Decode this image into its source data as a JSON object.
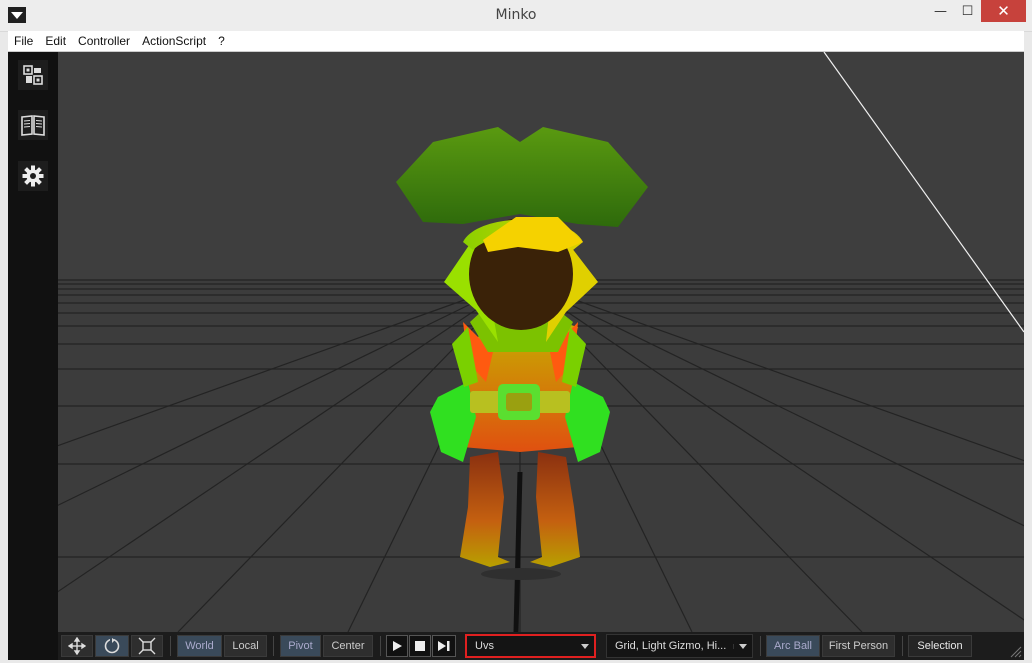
{
  "window": {
    "title": "Minko",
    "minimize": "—",
    "maximize": "☐",
    "close": "✕"
  },
  "menubar": {
    "items": [
      "File",
      "Edit",
      "Controller",
      "ActionScript",
      "?"
    ]
  },
  "sidebar": {
    "items": [
      "scene-graph-icon",
      "book-icon",
      "gear-icon"
    ]
  },
  "toolbar": {
    "transform_tools": [
      "move-icon",
      "rotate-icon",
      "scale-icon"
    ],
    "space": {
      "world": "World",
      "local": "Local",
      "active": "World"
    },
    "origin": {
      "pivot": "Pivot",
      "center": "Center",
      "active": "Pivot"
    },
    "playback": [
      "play-icon",
      "stop-icon",
      "step-icon"
    ],
    "render_mode": {
      "value": "Uvs"
    },
    "display_options": {
      "value": "Grid, Light Gizmo, Hi..."
    },
    "camera": {
      "arc_ball": "Arc Ball",
      "first_person": "First Person",
      "active": "Arc Ball"
    },
    "selection": "Selection"
  },
  "colors": {
    "accent_highlight": "#e02020",
    "viewport_bg": "#3d3d3d",
    "close_red": "#c7423c"
  }
}
